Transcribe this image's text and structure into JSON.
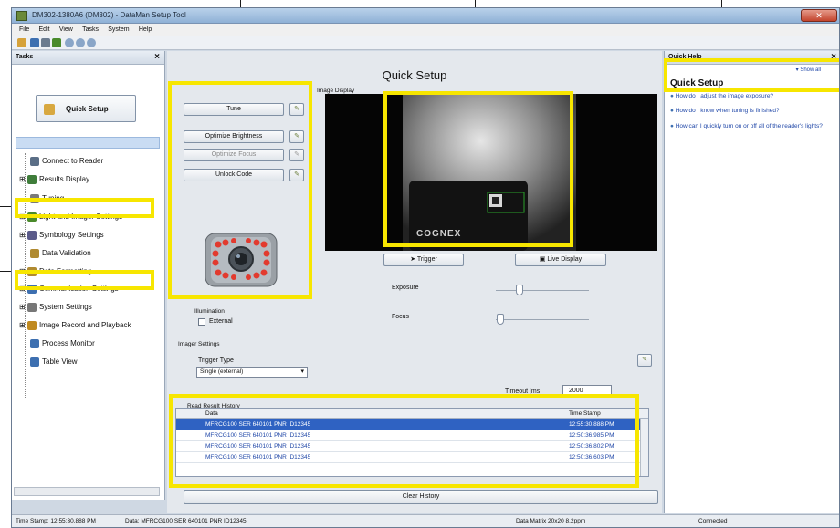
{
  "window": {
    "title": "DM302-1380A6 (DM302) - DataMan Setup Tool"
  },
  "menu": [
    "File",
    "Edit",
    "View",
    "Tasks",
    "System",
    "Help"
  ],
  "tasks_panel": {
    "title": "Tasks",
    "close": "×",
    "quick_setup_label": "Quick Setup",
    "items": [
      {
        "label": "Connect to Reader",
        "icon": "connect-icon",
        "color": "#5a6e86"
      },
      {
        "label": "Results Display",
        "icon": "results-display-icon",
        "color": "#3f7d3a"
      },
      {
        "label": "Tuning",
        "icon": "tuning-icon",
        "color": "#7a7a7a"
      },
      {
        "label": "Light and Imager Settings",
        "icon": "light-settings-icon",
        "color": "#4a8a2a"
      },
      {
        "label": "Symbology Settings",
        "icon": "symbology-icon",
        "color": "#5b5b8a"
      },
      {
        "label": "Data Validation",
        "icon": "data-validation-icon",
        "color": "#b08a30"
      },
      {
        "label": "Data Formatting",
        "icon": "data-formatting-icon",
        "color": "#b08a30"
      },
      {
        "label": "Communication Settings",
        "icon": "communication-icon",
        "color": "#3d6fb0"
      },
      {
        "label": "System Settings",
        "icon": "system-settings-icon",
        "color": "#777777"
      },
      {
        "label": "Image Record and Playback",
        "icon": "image-record-icon",
        "color": "#c08a20"
      },
      {
        "label": "Process Monitor",
        "icon": "process-monitor-icon",
        "color": "#3d6fb0"
      },
      {
        "label": "Table View",
        "icon": "table-view-icon",
        "color": "#3d6fb0"
      }
    ]
  },
  "main": {
    "title": "Quick Setup",
    "image_display_label": "Image Display",
    "tune_label": "Tune",
    "optimize_brightness_label": "Optimize Brightness",
    "optimize_focus_label": "Optimize Focus",
    "unlock_code_label": "Unlock Code",
    "logo_text": "COGNEX",
    "trigger_label": "Trigger",
    "live_display_label": "Live Display",
    "exposure_label": "Exposure",
    "focus_label": "Focus",
    "exposure_level": 0.25,
    "focus_level": 0.05,
    "illumination_label": "Illumination",
    "external_label": "External",
    "imager_settings_label": "Imager Settings",
    "trigger_type_label": "Trigger Type",
    "trigger_type_value": "Single (external)",
    "timeout_label": "Timeout [ms]",
    "timeout_value": "2000",
    "history_label": "Read Result History",
    "col_data": "Data",
    "col_time": "Time Stamp",
    "history_rows": [
      {
        "data": "MFRCG100 SER 640101 PNR ID12345",
        "time": "12:55:30.888 PM"
      },
      {
        "data": "MFRCG100 SER 640101 PNR ID12345",
        "time": "12:50:36.985 PM"
      },
      {
        "data": "MFRCG100 SER 640101 PNR ID12345",
        "time": "12:50:36.802 PM"
      },
      {
        "data": "MFRCG100 SER 640101 PNR ID12345",
        "time": "12:50:36.603 PM"
      }
    ],
    "clear_history_label": "Clear History"
  },
  "help_panel": {
    "title": "Quick Help",
    "close": "×",
    "show_all": "▾ Show all",
    "heading": "Quick Setup",
    "links": [
      "How do I adjust the image exposure?",
      "How do I know when tuning is finished?",
      "How can I quickly turn on or off all of the reader's lights?"
    ]
  },
  "status_bar": {
    "time_stamp": "Time Stamp: 12:55:30.888 PM",
    "data": "Data: MFRCG100 SER 640101 PNR ID12345",
    "symbology": "Data Matrix 20x20 8.2ppm",
    "connection": "Connected"
  },
  "colors": {
    "highlight": "#f7e600",
    "selection": "#2f62c2",
    "link": "#2148a8"
  }
}
